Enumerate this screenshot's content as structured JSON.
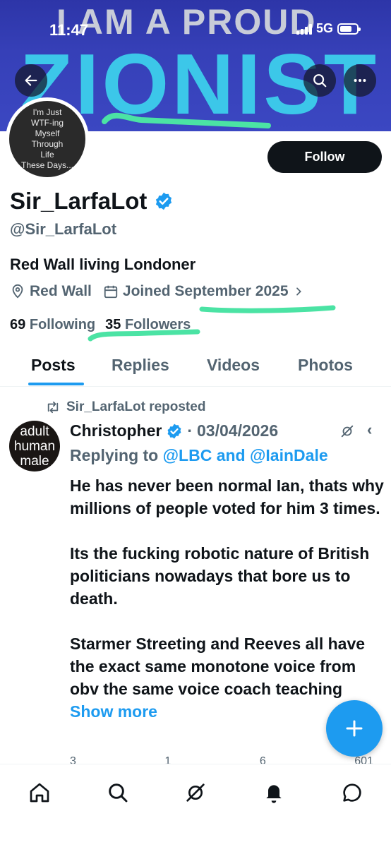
{
  "status_bar": {
    "time": "11:47",
    "network": "5G"
  },
  "banner": {
    "line1": "I AM A PROUD",
    "line2": "ZIONIST"
  },
  "avatar": {
    "lines": [
      "I'm Just",
      "WTF-ing",
      "Myself",
      "Through",
      "Life",
      "These Days..."
    ]
  },
  "profile": {
    "follow_label": "Follow",
    "display_name": "Sir_LarfaLot",
    "handle": "@Sir_LarfaLot",
    "bio": "Red Wall living Londoner",
    "location": "Red Wall",
    "joined": "Joined September 2025",
    "following_count": "69",
    "following_label": "Following",
    "followers_count": "35",
    "followers_label": "Followers"
  },
  "tabs": [
    {
      "label": "Posts",
      "active": true
    },
    {
      "label": "Replies",
      "active": false
    },
    {
      "label": "Videos",
      "active": false
    },
    {
      "label": "Photos",
      "active": false
    }
  ],
  "post": {
    "repost_label": "Sir_LarfaLot reposted",
    "avatar_lines": [
      "adult",
      "human",
      "male"
    ],
    "author": "Christopher",
    "separator": "·",
    "date": "03/04/2026",
    "more": "‹",
    "replying_prefix": "Replying to",
    "replying_to": "@LBC and @IainDale",
    "paragraphs": [
      "He has never been normal Ian, thats why millions of people voted for him 3 times.",
      "Its the fucking robotic nature of British politicians nowadays that bore us to death.",
      "Starmer Streeting and Reeves all have the exact same monotone voice from obv the same voice coach teaching"
    ],
    "show_more": "Show more",
    "counts": {
      "replies": "3",
      "reposts": "1",
      "likes": "6",
      "views": "601"
    }
  },
  "colors": {
    "accent": "#1d9bf0",
    "highlight": "#4be3a4",
    "text": "#0f1419",
    "secondary": "#536471"
  },
  "icons": [
    "back-arrow-icon",
    "search-icon",
    "more-icon",
    "verified-icon",
    "location-icon",
    "calendar-icon",
    "chevron-right-icon",
    "repost-icon",
    "grok-icon",
    "compose-icon",
    "home-icon",
    "explore-icon",
    "notifications-icon",
    "messages-icon"
  ]
}
